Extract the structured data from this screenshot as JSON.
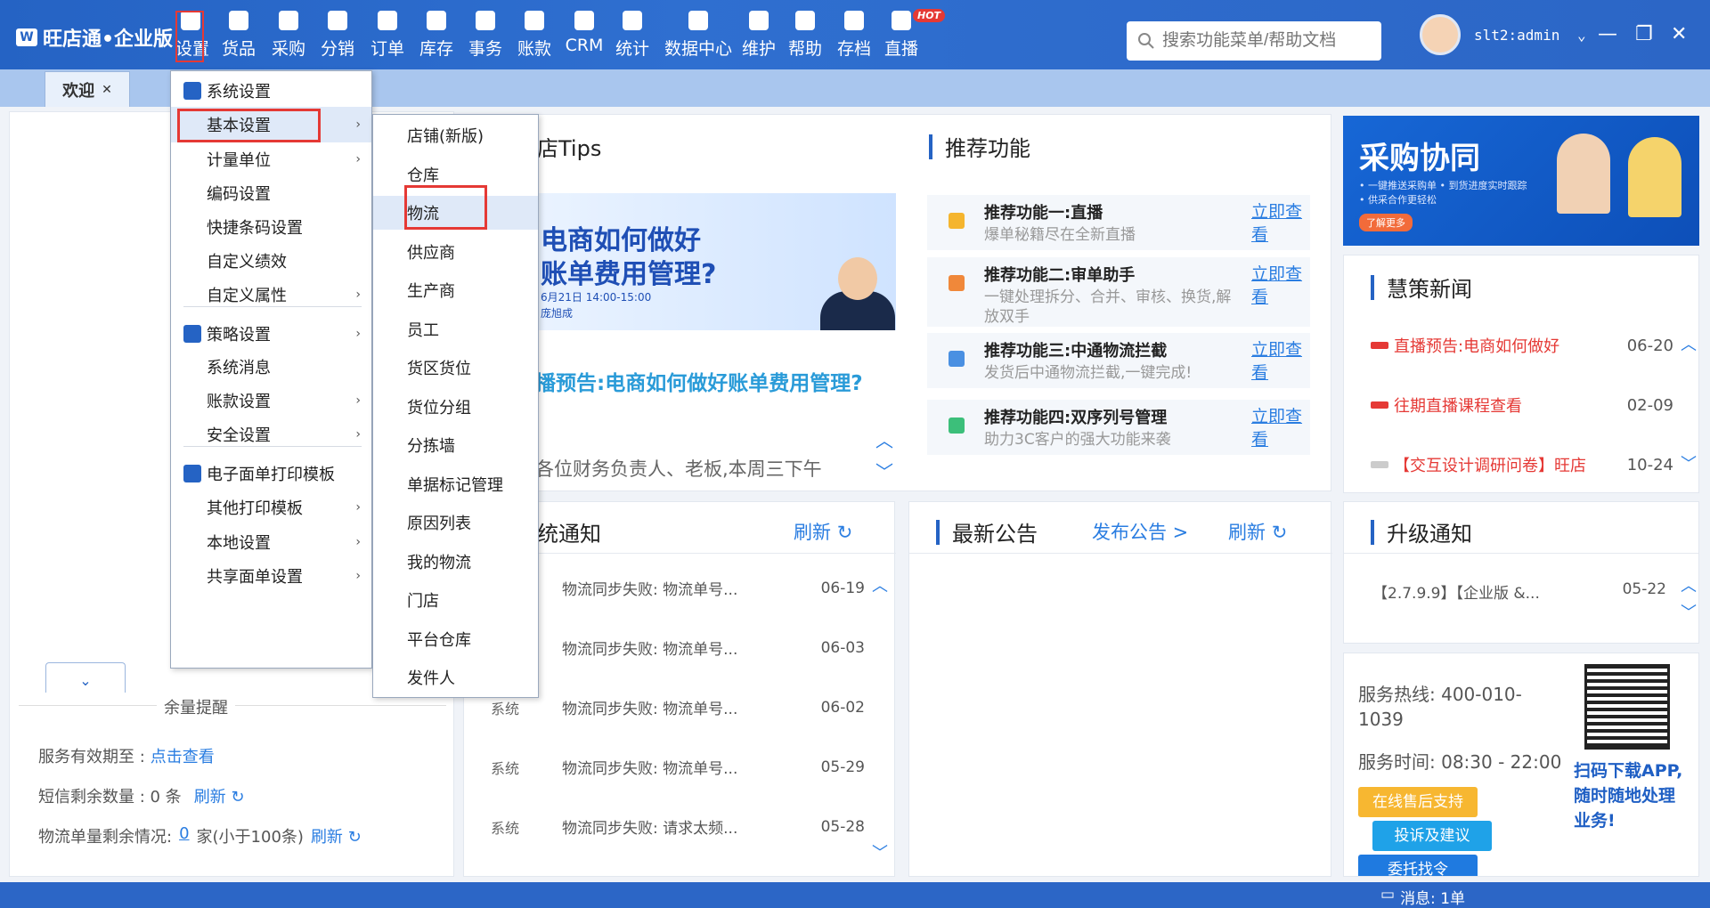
{
  "app": {
    "title": "旺店通•企业版"
  },
  "nav": [
    {
      "label": "设置",
      "icon": "gear-icon"
    },
    {
      "label": "货品",
      "icon": "box-icon"
    },
    {
      "label": "采购",
      "icon": "cart-icon"
    },
    {
      "label": "分销",
      "icon": "distribution-icon"
    },
    {
      "label": "订单",
      "icon": "order-icon"
    },
    {
      "label": "库存",
      "icon": "inventory-icon"
    },
    {
      "label": "事务",
      "icon": "chat-icon"
    },
    {
      "label": "账款",
      "icon": "yen-icon"
    },
    {
      "label": "CRM",
      "icon": "person-icon"
    },
    {
      "label": "统计",
      "icon": "pie-chart-icon"
    },
    {
      "label": "数据中心",
      "icon": "bar-chart-icon"
    },
    {
      "label": "维护",
      "icon": "wrench-icon"
    },
    {
      "label": "帮助",
      "icon": "help-icon"
    },
    {
      "label": "存档",
      "icon": "archive-icon"
    },
    {
      "label": "直播",
      "icon": "live-icon"
    }
  ],
  "hot_badge": "HOT",
  "search": {
    "placeholder": "搜索功能菜单/帮助文档"
  },
  "user": {
    "name": "slt2:admin"
  },
  "tabs": [
    {
      "label": "欢迎"
    }
  ],
  "menu_level1": [
    {
      "label": "系统设置",
      "icon": "gear-icon",
      "arrow": false
    },
    {
      "label": "基本设置",
      "arrow": true,
      "highlight": true
    },
    {
      "label": "计量单位",
      "arrow": true
    },
    {
      "label": "编码设置",
      "arrow": false
    },
    {
      "label": "快捷条码设置",
      "arrow": false
    },
    {
      "label": "自定义绩效",
      "arrow": false
    },
    {
      "label": "自定义属性",
      "arrow": true
    },
    {
      "label": "策略设置",
      "icon": "layers-icon",
      "arrow": true
    },
    {
      "label": "系统消息",
      "arrow": false
    },
    {
      "label": "账款设置",
      "arrow": true
    },
    {
      "label": "安全设置",
      "arrow": true
    },
    {
      "label": "电子面单打印模板",
      "icon": "printer-icon",
      "arrow": false
    },
    {
      "label": "其他打印模板",
      "arrow": true
    },
    {
      "label": "本地设置",
      "arrow": true
    },
    {
      "label": "共享面单设置",
      "arrow": true
    }
  ],
  "menu_level2": [
    "店铺(新版)",
    "仓库",
    "物流",
    "供应商",
    "生产商",
    "员工",
    "货区货位",
    "货位分组",
    "分拣墙",
    "单据标记管理",
    "原因列表",
    "我的物流",
    "门店",
    "平台仓库",
    "发件人"
  ],
  "tips": {
    "title": "店Tips",
    "banner_line1": "电商如何做好",
    "banner_line2": "账单费用管理?",
    "banner_date": "6月21日 14:00-15:00",
    "banner_host": "庞旭成",
    "headline": "播预告:电商如何做好账单费用管理?",
    "body": "各位财务负责人、老板,本周三下午"
  },
  "recommend": {
    "title": "推荐功能",
    "items": [
      {
        "title": "推荐功能一:直播",
        "desc": "爆单秘籍尽在全新直播",
        "link": "立即查看",
        "color": "#f5b52e"
      },
      {
        "title": "推荐功能二:审单助手",
        "desc": "一键处理拆分、合并、审核、换货,解放双手",
        "link": "立即查看",
        "color": "#f0883a"
      },
      {
        "title": "推荐功能三:中通物流拦截",
        "desc": "发货后中通物流拦截,一键完成!",
        "link": "立即查看",
        "color": "#4a90e2"
      },
      {
        "title": "推荐功能四:双序列号管理",
        "desc": "助力3C客户的强大功能来袭",
        "link": "立即查看",
        "color": "#3cbf7a"
      }
    ]
  },
  "ad": {
    "title": "采购协同",
    "line1": "• 一键推送采购单 • 到货进度实时跟踪",
    "line2": "• 供采合作更轻松",
    "button": "了解更多"
  },
  "news": {
    "title": "慧策新闻",
    "items": [
      {
        "text": "直播预告:电商如何做好",
        "date": "06-20",
        "hot": true
      },
      {
        "text": "往期直播课程查看",
        "date": "02-09",
        "hot": true
      },
      {
        "text": "【交互设计调研问卷】旺店",
        "date": "10-24",
        "hot": false
      }
    ]
  },
  "sys_notice": {
    "title": "统通知",
    "refresh": "刷新",
    "items": [
      {
        "source": "",
        "text": "物流同步失败: 物流单号...",
        "date": "06-19"
      },
      {
        "source": "",
        "text": "物流同步失败: 物流单号...",
        "date": "06-03"
      },
      {
        "source": "系统",
        "text": "物流同步失败: 物流单号...",
        "date": "06-02"
      },
      {
        "source": "系统",
        "text": "物流同步失败: 物流单号...",
        "date": "05-29"
      },
      {
        "source": "系统",
        "text": "物流同步失败: 请求太频...",
        "date": "05-28"
      }
    ]
  },
  "announce": {
    "title": "最新公告",
    "publish": "发布公告 >",
    "refresh": "刷新"
  },
  "upgrade": {
    "title": "升级通知",
    "items": [
      {
        "text": "【2.7.9.9】【企业版 &...",
        "date": "05-22"
      }
    ]
  },
  "service": {
    "hotline": "服务热线: 400-010-1039",
    "hours": "服务时间: 08:30 - 22:00",
    "btn_support": "在线售后支持",
    "btn_feedback": "投诉及建议",
    "btn_more": "委托找令",
    "qr_caption": "扫码下载APP,随时随地处理业务!"
  },
  "balance": {
    "title": "余量提醒",
    "validity_label": "服务有效期至 :",
    "validity_link": "点击查看",
    "sms_label": "短信剩余数量 : 0 条",
    "sms_refresh": "刷新",
    "logistics_label": "物流单量剩余情况:",
    "logistics_count": "0",
    "logistics_suffix": "家(小于100条)",
    "logistics_refresh": "刷新"
  },
  "statusbar": {
    "message": "消息: 1单"
  }
}
